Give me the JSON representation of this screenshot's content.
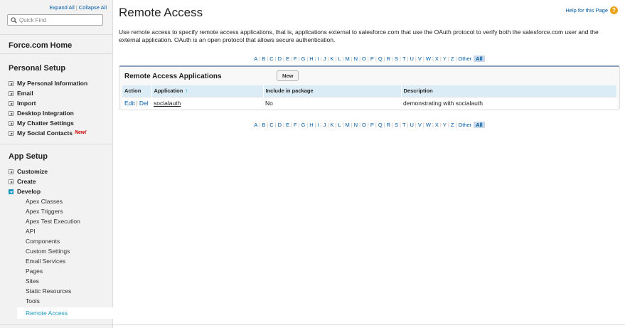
{
  "sidebar": {
    "expand_all": "Expand All",
    "collapse_all": "Collapse All",
    "separator": "|",
    "quick_find_placeholder": "Quick Find",
    "home_label": "Force.com Home",
    "personal_setup": {
      "title": "Personal Setup",
      "items": [
        {
          "label": "My Personal Information"
        },
        {
          "label": "Email"
        },
        {
          "label": "Import"
        },
        {
          "label": "Desktop Integration"
        },
        {
          "label": "My Chatter Settings"
        },
        {
          "label": "My Social Contacts",
          "badge": "New!"
        }
      ]
    },
    "app_setup": {
      "title": "App Setup",
      "items": [
        {
          "label": "Customize"
        },
        {
          "label": "Create"
        },
        {
          "label": "Develop"
        }
      ],
      "develop_items": [
        "Apex Classes",
        "Apex Triggers",
        "Apex Test Execution",
        "API",
        "Components",
        "Custom Settings",
        "Email Services",
        "Pages",
        "Sites",
        "Static Resources",
        "Tools"
      ],
      "selected_item": "Remote Access"
    }
  },
  "main": {
    "title": "Remote Access",
    "help_link": "Help for this Page",
    "help_icon": "question-icon",
    "description": "Use remote access to specify remote access applications, that is, applications external to salesforce.com that use the OAuth protocol to verify both the salesforce.com user and the external application. OAuth is an open protocol that allows secure authentication.",
    "alphabet": [
      "A",
      "B",
      "C",
      "D",
      "E",
      "F",
      "G",
      "H",
      "I",
      "J",
      "K",
      "L",
      "M",
      "N",
      "O",
      "P",
      "Q",
      "R",
      "S",
      "T",
      "U",
      "V",
      "W",
      "X",
      "Y",
      "Z"
    ],
    "alpha_other": "Other",
    "alpha_all": "All",
    "panel": {
      "title": "Remote Access Applications",
      "new_button": "New",
      "columns": [
        "Action",
        "Application",
        "Include in package",
        "Description"
      ],
      "sort_indicator": "↑",
      "rows": [
        {
          "edit": "Edit",
          "del": "Del",
          "action_sep": "|",
          "application": "socialauth",
          "include_in_package": "No",
          "description": "demonstrating with socialauth"
        }
      ]
    }
  },
  "colors": {
    "link": "#015ba7",
    "accent": "#1797c0",
    "header_bg": "#dbecf6",
    "new_badge": "#cc0000",
    "help_icon": "#e8a318"
  }
}
